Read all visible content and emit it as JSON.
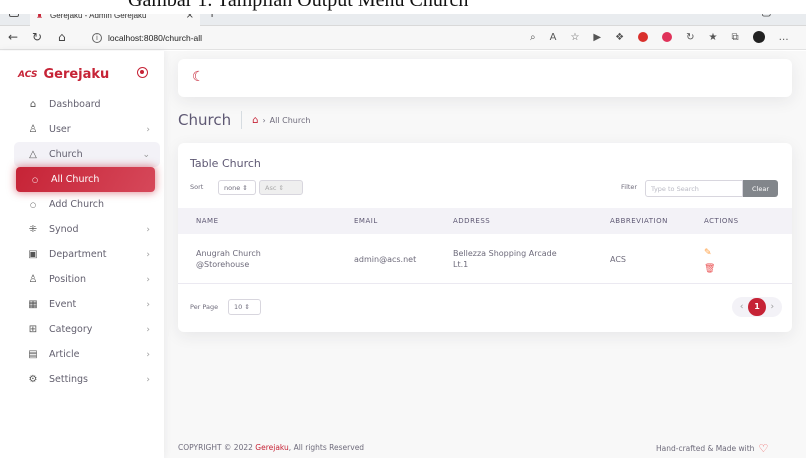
{
  "caption": "Gambar 1. Tampilan Output Menu Church",
  "browser": {
    "tab_title": "Gerejaku - Admin Gerejaku",
    "tab_close": "×",
    "new_tab": "+",
    "url": "localhost:8080/church-all",
    "window_controls": [
      "–",
      "▢",
      "×"
    ]
  },
  "sidebar": {
    "brand": "Gerejaku",
    "brand_logo_text": "ACS",
    "items": [
      {
        "label": "Dashboard",
        "icon": "home-icon"
      },
      {
        "label": "User",
        "icon": "user-icon"
      },
      {
        "label": "Church",
        "icon": "triangle-icon"
      },
      {
        "label": "All Church",
        "icon": "circle-icon"
      },
      {
        "label": "Add Church",
        "icon": "circle-icon"
      },
      {
        "label": "Synod",
        "icon": "synod-icon"
      },
      {
        "label": "Department",
        "icon": "department-icon"
      },
      {
        "label": "Position",
        "icon": "position-icon"
      },
      {
        "label": "Event",
        "icon": "calendar-icon"
      },
      {
        "label": "Category",
        "icon": "grid-icon"
      },
      {
        "label": "Article",
        "icon": "document-icon"
      },
      {
        "label": "Settings",
        "icon": "gear-icon"
      }
    ]
  },
  "page": {
    "title": "Church",
    "breadcrumb": "All Church"
  },
  "card": {
    "title": "Table Church",
    "sort_label": "Sort",
    "sort_value": "none",
    "sort_order": "Asc",
    "filter_label": "Filter",
    "filter_placeholder": "Type to Search",
    "clear_label": "Clear",
    "columns": [
      "NAME",
      "EMAIL",
      "ADDRESS",
      "ABBREVIATION",
      "ACTIONS"
    ],
    "rows": [
      {
        "name_line1": "Anugrah Church",
        "name_line2": "@Storehouse",
        "email": "admin@acs.net",
        "address_line1": "Bellezza Shopping Arcade",
        "address_line2": "Lt.1",
        "abbreviation": "ACS"
      }
    ],
    "per_page_label": "Per Page",
    "per_page_value": "10",
    "current_page": "1"
  },
  "footer": {
    "copyright_prefix": "COPYRIGHT © 2022",
    "copyright_brand": "Gerejaku",
    "copyright_suffix": ", All rights Reserved",
    "right_text": "Hand-crafted & Made with"
  },
  "colors": {
    "accent": "#c62336",
    "edit": "#ff9f43",
    "delete": "#ea5455"
  }
}
